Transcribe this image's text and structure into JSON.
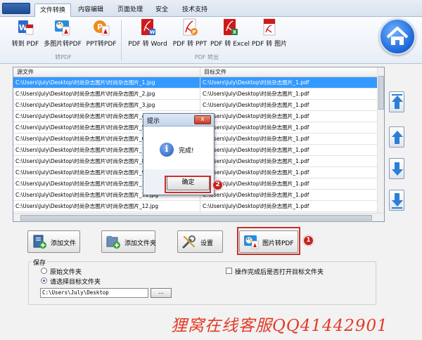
{
  "tabs": [
    {
      "label": "文件转换",
      "active": true
    },
    {
      "label": "内容编辑",
      "active": false
    },
    {
      "label": "页面处理",
      "active": false
    },
    {
      "label": "安全",
      "active": false
    },
    {
      "label": "技术支持",
      "active": false
    }
  ],
  "ribbon": {
    "to_pdf_group": "转PDF",
    "pdf_out_group": "PDF 转出",
    "buttons": {
      "to_pdf": "转到 PDF",
      "img_to_pdf": "多图片转PDF",
      "ppt_to_pdf": "PPT转PDF",
      "pdf_to_word": "PDF 转 Word",
      "pdf_to_ppt": "PDF 转 PPT",
      "pdf_to_excel": "PDF 转 Excel",
      "pdf_to_image": "PDF 转 图片"
    }
  },
  "table": {
    "headers": [
      "源文件",
      "目标文件"
    ],
    "rows": [
      [
        "C:\\Users\\July\\Desktop\\时尚杂志图片\\时尚杂志图片_1.jpg",
        "C:\\Users\\July\\Desktop\\时尚杂志图片_1.pdf"
      ],
      [
        "C:\\Users\\July\\Desktop\\时尚杂志图片\\时尚杂志图片_2.jpg",
        "C:\\Users\\July\\Desktop\\时尚杂志图片_1.pdf"
      ],
      [
        "C:\\Users\\July\\Desktop\\时尚杂志图片\\时尚杂志图片_3.jpg",
        "C:\\Users\\July\\Desktop\\时尚杂志图片_1.pdf"
      ],
      [
        "C:\\Users\\July\\Desktop\\时尚杂志图片\\时尚杂志图片_4.jpg",
        "C:\\Users\\July\\Desktop\\时尚杂志图片_1.pdf"
      ],
      [
        "C:\\Users\\July\\Desktop\\时尚杂志图片\\时尚杂志图片_5.jpg",
        "C:\\Users\\July\\Desktop\\时尚杂志图片_1.pdf"
      ],
      [
        "C:\\Users\\July\\Desktop\\时尚杂志图片\\时尚杂志图片_6.jpg",
        "C:\\Users\\July\\Desktop\\时尚杂志图片_1.pdf"
      ],
      [
        "C:\\Users\\July\\Desktop\\时尚杂志图片\\时尚杂志图片_7.jpg",
        "C:\\Users\\July\\Desktop\\时尚杂志图片_1.pdf"
      ],
      [
        "C:\\Users\\July\\Desktop\\时尚杂志图片\\时尚杂志图片_8.jpg",
        "C:\\Users\\July\\Desktop\\时尚杂志图片_1.pdf"
      ],
      [
        "C:\\Users\\July\\Desktop\\时尚杂志图片\\时尚杂志图片_9.jpg",
        "C:\\Users\\July\\Desktop\\时尚杂志图片_1.pdf"
      ],
      [
        "C:\\Users\\July\\Desktop\\时尚杂志图片\\时尚杂志图片_10.jpg",
        "C:\\Users\\July\\Desktop\\时尚杂志图片_1.pdf"
      ],
      [
        "C:\\Users\\July\\Desktop\\时尚杂志图片\\时尚杂志图片_11.jpg",
        "C:\\Users\\July\\Desktop\\时尚杂志图片_1.pdf"
      ],
      [
        "C:\\Users\\July\\Desktop\\时尚杂志图片\\时尚杂志图片_12.jpg",
        "C:\\Users\\July\\Desktop\\时尚杂志图片_1.pdf"
      ]
    ],
    "selected_row": 0
  },
  "dialog": {
    "title": "提示",
    "close": "x",
    "message": "完成!",
    "ok": "确定",
    "info_glyph": "i"
  },
  "markers": {
    "one": "1",
    "two": "2"
  },
  "actions": {
    "add_file": "添加文件",
    "add_folder": "添加文件夹",
    "settings": "设置",
    "convert": "图片转PDF"
  },
  "save": {
    "title": "保存",
    "opt_original": "原始文件夹",
    "opt_target": "请选择目标文件夹",
    "selected": "target",
    "path": "C:\\Users\\July\\Desktop",
    "browse": "...",
    "open_after": "操作完成后是否打开目标文件夹",
    "open_after_checked": false
  },
  "watermark": "狸窝在线客服QQ41442901",
  "colors": {
    "accent": "#3399ff",
    "highlight": "#c8302a",
    "watermark": "#e23a26"
  }
}
